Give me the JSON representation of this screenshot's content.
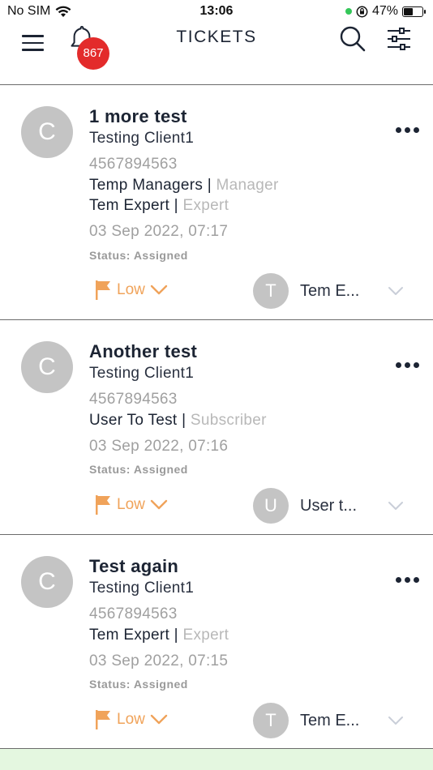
{
  "status_bar": {
    "carrier": "No SIM",
    "time": "13:06",
    "battery": "47%",
    "battery_level": 0.47
  },
  "header": {
    "title": "TICKETS",
    "notification_count": "867"
  },
  "tickets": [
    {
      "avatar_letter": "C",
      "title": "1 more test",
      "client": "Testing Client1",
      "phone": "4567894563",
      "assignments": [
        {
          "name": "Temp Managers",
          "sep": " | ",
          "role": "Manager"
        },
        {
          "name": "Tem Expert",
          "sep": " | ",
          "role": "Expert"
        }
      ],
      "datetime": "03 Sep 2022, 07:17",
      "status": "Status: Assigned",
      "priority": "Low",
      "assignee_letter": "T",
      "assignee_name": "Tem E..."
    },
    {
      "avatar_letter": "C",
      "title": "Another test",
      "client": "Testing Client1",
      "phone": "4567894563",
      "assignments": [
        {
          "name": "User To Test",
          "sep": " | ",
          "role": "Subscriber"
        }
      ],
      "datetime": "03 Sep 2022, 07:16",
      "status": "Status: Assigned",
      "priority": "Low",
      "assignee_letter": "U",
      "assignee_name": "User t..."
    },
    {
      "avatar_letter": "C",
      "title": "Test again",
      "client": "Testing Client1",
      "phone": "4567894563",
      "assignments": [
        {
          "name": "Tem Expert",
          "sep": " | ",
          "role": "Expert"
        }
      ],
      "datetime": "03 Sep 2022, 07:15",
      "status": "Status: Assigned",
      "priority": "Low",
      "assignee_letter": "T",
      "assignee_name": "Tem E..."
    }
  ],
  "colors": {
    "accent": "#f0a35a",
    "badge": "#e32b2b",
    "avatar": "#c4c4c4",
    "text": "#1c2433"
  },
  "icons": [
    "wifi-icon",
    "orientation-lock-icon",
    "battery-icon",
    "menu-icon",
    "bell-icon",
    "search-icon",
    "filter-icon",
    "more-icon",
    "flag-icon",
    "chevron-down-icon"
  ]
}
